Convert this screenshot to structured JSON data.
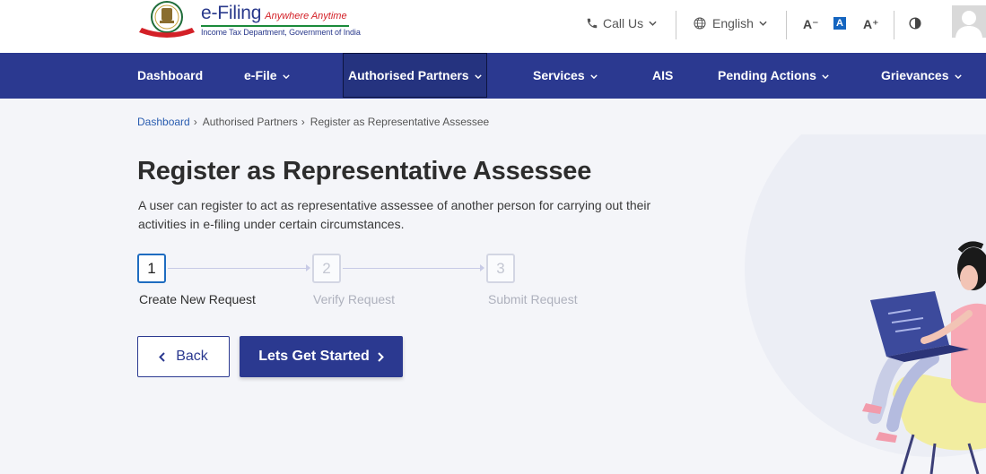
{
  "header": {
    "brand_name": "e-Filing",
    "brand_tagline": "Anywhere Anytime",
    "brand_subtitle": "Income Tax Department, Government of India",
    "call_us": "Call Us",
    "language": "English",
    "font_decrease": "A⁻",
    "font_normal": "A",
    "font_increase": "A⁺"
  },
  "nav": {
    "items": [
      {
        "label": "Dashboard",
        "has_dropdown": false
      },
      {
        "label": "e-File",
        "has_dropdown": true
      },
      {
        "label": "Authorised Partners",
        "has_dropdown": true,
        "active": true
      },
      {
        "label": "Services",
        "has_dropdown": true
      },
      {
        "label": "AIS",
        "has_dropdown": false
      },
      {
        "label": "Pending Actions",
        "has_dropdown": true
      },
      {
        "label": "Grievances",
        "has_dropdown": true
      }
    ]
  },
  "breadcrumb": {
    "items": [
      "Dashboard",
      "Authorised Partners",
      "Register as Representative Assessee"
    ]
  },
  "page": {
    "title": "Register as Representative Assessee",
    "description": "A user can register to act as representative assessee of another person for carrying out their activities in e-filing under certain circumstances."
  },
  "stepper": {
    "steps": [
      {
        "number": "1",
        "label": "Create New Request",
        "active": true
      },
      {
        "number": "2",
        "label": "Verify Request",
        "active": false
      },
      {
        "number": "3",
        "label": "Submit Request",
        "active": false
      }
    ]
  },
  "actions": {
    "back_label": "Back",
    "start_label": "Lets Get Started"
  },
  "colors": {
    "primary": "#2b3990",
    "link": "#2a5db0",
    "active_step": "#1e6cc0",
    "background": "#f4f5f9"
  }
}
